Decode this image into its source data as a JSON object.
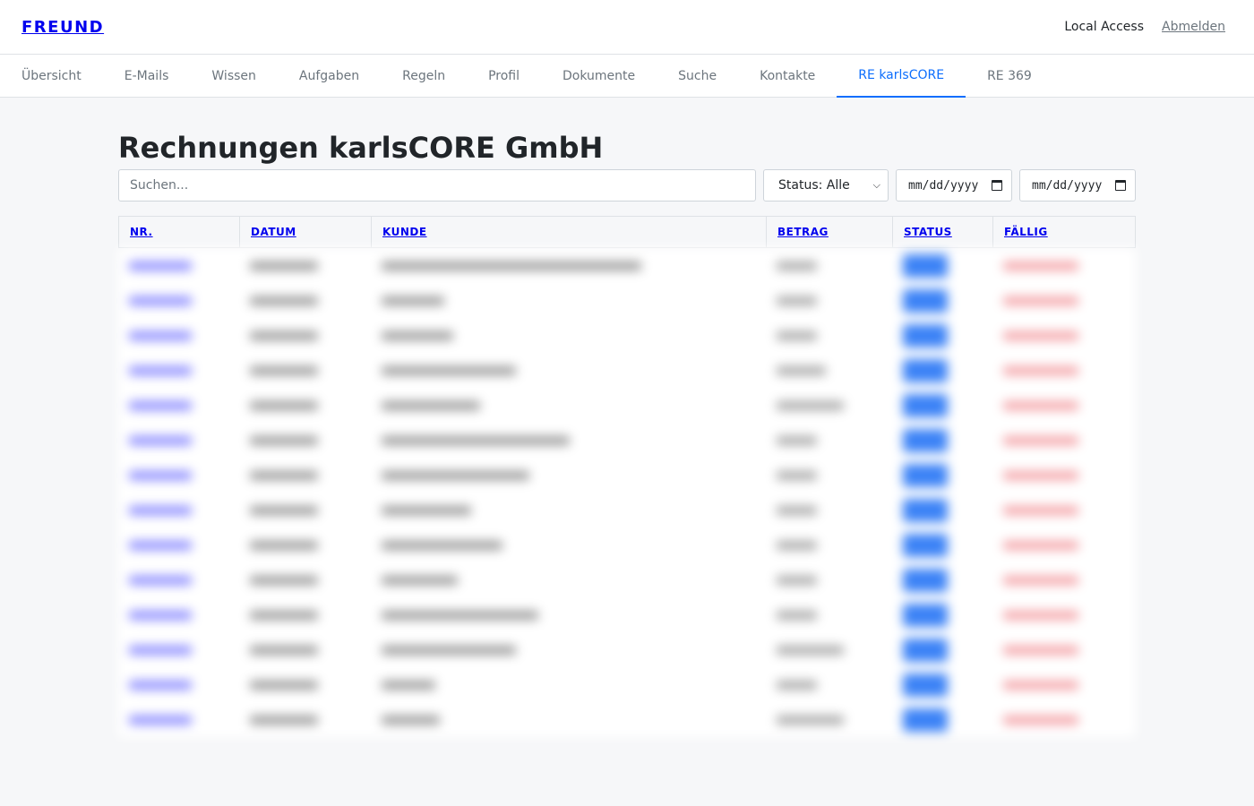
{
  "app": {
    "brand": "FREUND",
    "access_label": "Local Access",
    "logout_label": "Abmelden"
  },
  "nav": {
    "items": [
      {
        "label": "Übersicht",
        "active": false
      },
      {
        "label": "E-Mails",
        "active": false
      },
      {
        "label": "Wissen",
        "active": false
      },
      {
        "label": "Aufgaben",
        "active": false
      },
      {
        "label": "Regeln",
        "active": false
      },
      {
        "label": "Profil",
        "active": false
      },
      {
        "label": "Dokumente",
        "active": false
      },
      {
        "label": "Suche",
        "active": false
      },
      {
        "label": "Kontakte",
        "active": false
      },
      {
        "label": "RE karlsCORE",
        "active": true
      },
      {
        "label": "RE 369",
        "active": false
      }
    ]
  },
  "page": {
    "title": "Rechnungen karlsCORE GmbH"
  },
  "filters": {
    "search_placeholder": "Suchen...",
    "status_selected": "Status: Alle",
    "date_from_placeholder": "mm/dd/yyyy",
    "date_to_placeholder": "mm/dd/yyyy"
  },
  "table": {
    "columns": [
      "NR.",
      "DATUM",
      "KUNDE",
      "BETRAG",
      "STATUS",
      "FÄLLIG"
    ],
    "rows_blurred": true,
    "row_count": 14
  },
  "colors": {
    "accent": "#0d6efd",
    "link": "#0000ee",
    "status_blue": "#3b82f6",
    "due_red": "#f4a3a8"
  }
}
